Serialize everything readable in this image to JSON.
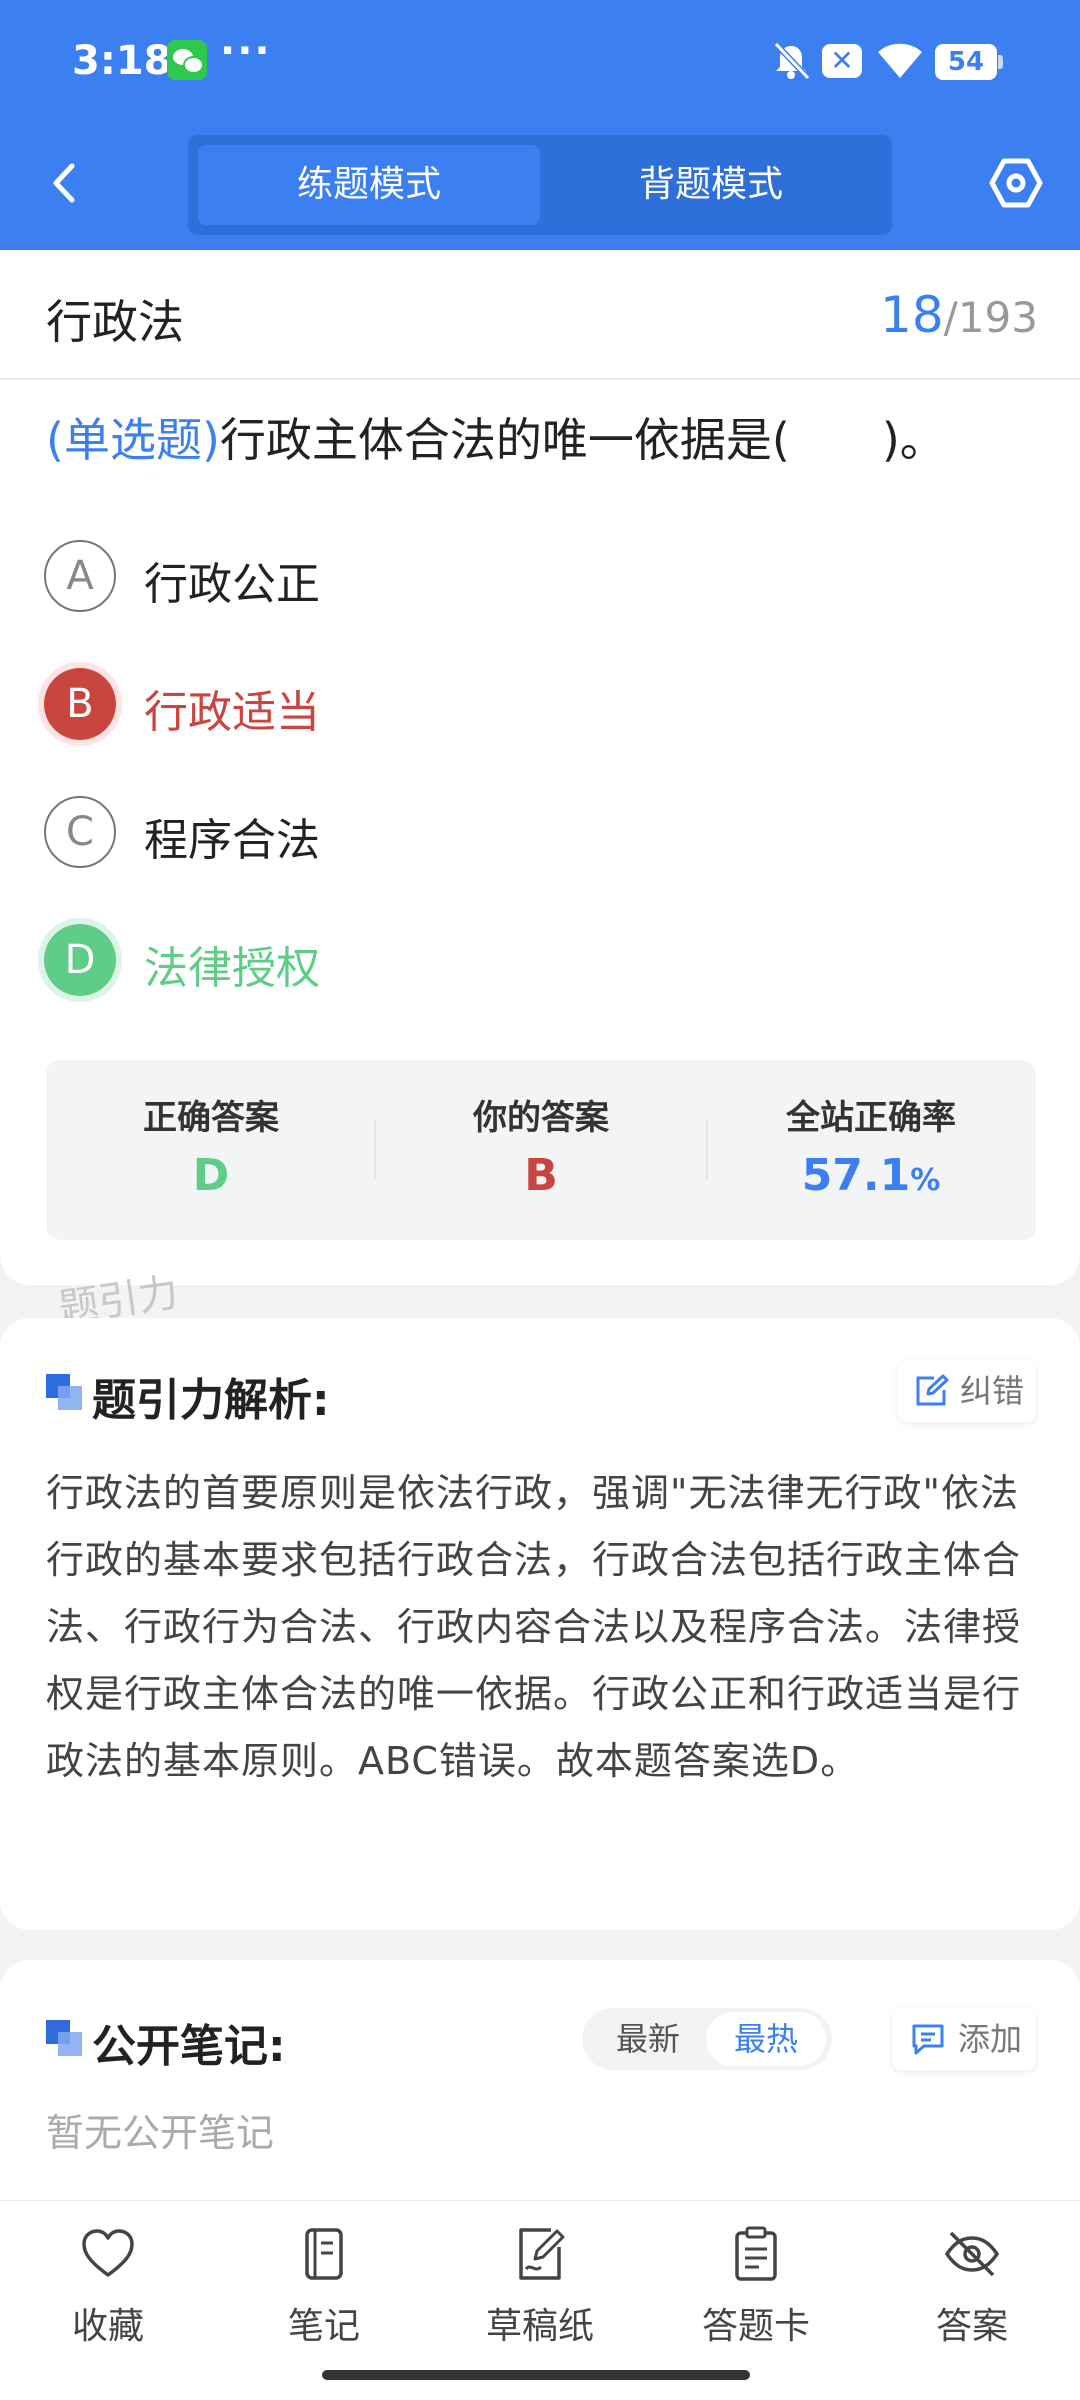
{
  "status_bar": {
    "time": "3:18",
    "dots": "···",
    "battery": "54",
    "x_badge": "✕"
  },
  "header": {
    "modes": [
      "练题模式",
      "背题模式"
    ],
    "active_mode": "练题模式"
  },
  "question": {
    "subject": "行政法",
    "current": "18",
    "separator": "/",
    "total": "193",
    "type": "(单选题)",
    "text": "行政主体合法的唯一依据是(　　)。",
    "options": [
      {
        "letter": "A",
        "text": "行政公正",
        "state": "normal"
      },
      {
        "letter": "B",
        "text": "行政适当",
        "state": "wrong"
      },
      {
        "letter": "C",
        "text": "程序合法",
        "state": "normal"
      },
      {
        "letter": "D",
        "text": "法律授权",
        "state": "correct"
      }
    ]
  },
  "answer_summary": {
    "correct_label": "正确答案",
    "correct_value": "D",
    "yours_label": "你的答案",
    "yours_value": "B",
    "rate_label": "全站正确率",
    "rate_value": "57.1",
    "rate_unit": "%"
  },
  "watermark": "题引力",
  "analysis": {
    "title": "题引力解析:",
    "correct_button": "纠错",
    "text": "行政法的首要原则是依法行政，强调\"无法律无行政\"依法行政的基本要求包括行政合法，行政合法包括行政主体合法、行政行为合法、行政内容合法以及程序合法。法律授权是行政主体合法的唯一依据。行政公正和行政适当是行政法的基本原则。ABC错误。故本题答案选D。"
  },
  "notes": {
    "title": "公开笔记:",
    "sort_tabs": [
      "最新",
      "最热"
    ],
    "active_sort": "最热",
    "add_button": "添加",
    "empty_text": "暂无公开笔记"
  },
  "bottom_bar": [
    {
      "label": "收藏",
      "icon": "heart-icon"
    },
    {
      "label": "笔记",
      "icon": "notebook-icon"
    },
    {
      "label": "草稿纸",
      "icon": "draft-icon"
    },
    {
      "label": "答题卡",
      "icon": "answer-sheet-icon"
    },
    {
      "label": "答案",
      "icon": "eye-off-icon"
    }
  ],
  "colors": {
    "primary": "#3b7ff0",
    "wrong": "#c9453f",
    "correct": "#5fcd86"
  }
}
